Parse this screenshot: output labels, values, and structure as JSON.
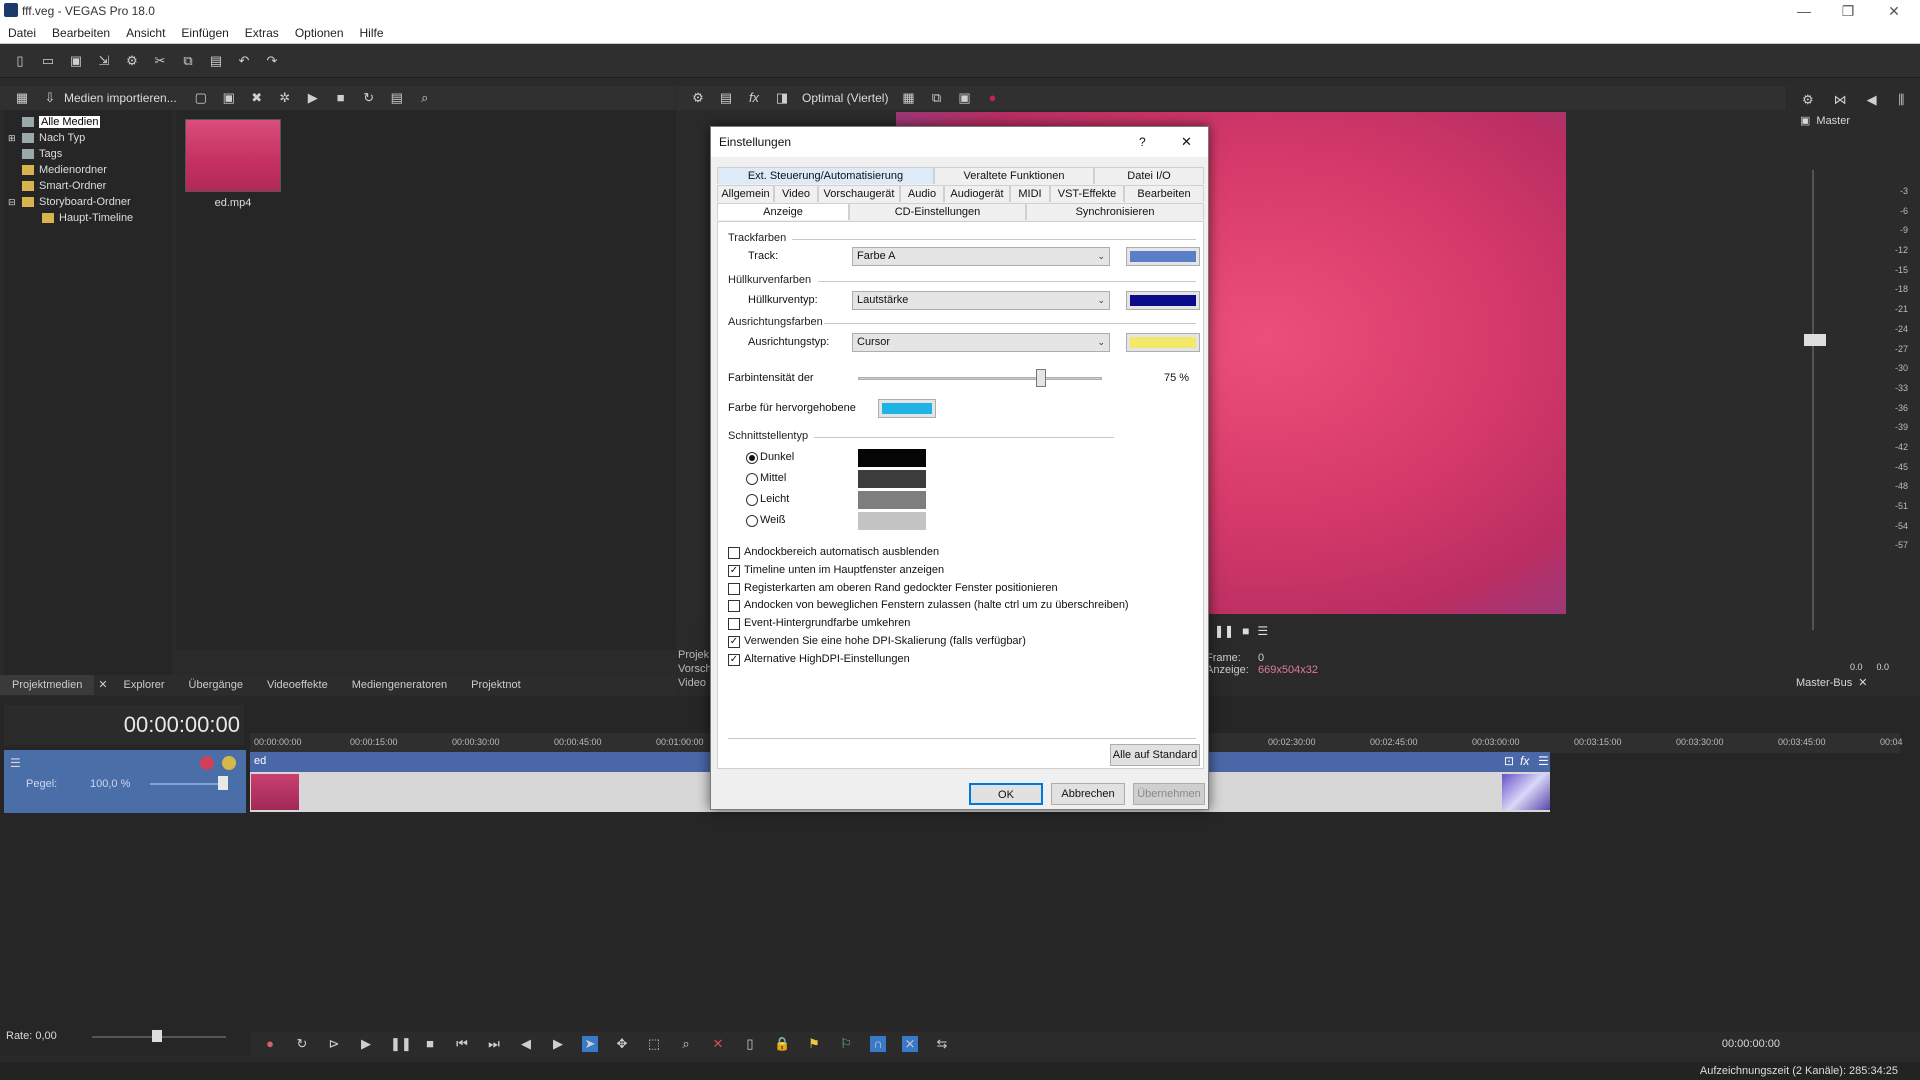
{
  "window": {
    "title": "fff.veg - VEGAS Pro 18.0"
  },
  "menu": [
    "Datei",
    "Bearbeiten",
    "Ansicht",
    "Einfügen",
    "Extras",
    "Optionen",
    "Hilfe"
  ],
  "media": {
    "import_label": "Medien importieren...",
    "tree": [
      "Alle Medien",
      "Nach Typ",
      "Tags",
      "Medienordner",
      "Smart-Ordner",
      "Storyboard-Ordner",
      "Haupt-Timeline"
    ],
    "file_name": "ed.mp4"
  },
  "bottom_tabs": [
    "Projektmedien",
    "Explorer",
    "Übergänge",
    "Videoeffekte",
    "Mediengeneratoren",
    "Projektnot"
  ],
  "preview": {
    "quality": "Optimal (Viertel)",
    "frame_label": "Frame:",
    "frame_value": "0",
    "display_label": "Anzeige:",
    "display_value": "669x504x32",
    "side_labels": [
      "Projek",
      "Vorsch",
      "Video"
    ]
  },
  "master": {
    "title": "Master",
    "tab": "Master-Bus",
    "scale": [
      "3",
      "6",
      "9",
      "12",
      "15",
      "18",
      "21",
      "24",
      "27",
      "30",
      "33",
      "36",
      "39",
      "42",
      "45",
      "48",
      "51",
      "54",
      "57"
    ],
    "left_value": "0.0",
    "right_value": "0.0"
  },
  "timeline": {
    "timecode": "00:00:00:00",
    "level_label": "Pegel:",
    "level_value": "100,0 %",
    "track_name": "ed",
    "ruler": [
      "00:00:00:00",
      "00:00:15:00",
      "00:00:30:00",
      "00:00:45:00",
      "00:01:00:00",
      "00:02:30:00",
      "00:02:45:00",
      "00:03:00:00",
      "00:03:15:00",
      "00:03:30:00",
      "00:03:45:00",
      "00:04"
    ],
    "rate": "Rate: 0,00",
    "position": "00:00:00:00"
  },
  "status": {
    "text": "Aufzeichnungszeit (2 Kanäle): 285:34:25"
  },
  "dialog": {
    "title": "Einstellungen",
    "help": "?",
    "close": "✕",
    "tabs_row1": [
      "Ext. Steuerung/Automatisierung",
      "Veraltete Funktionen",
      "Datei I/O"
    ],
    "tabs_row2": [
      "Allgemein",
      "Video",
      "Vorschaugerät",
      "Audio",
      "Audiogerät",
      "MIDI",
      "VST-Effekte",
      "Bearbeiten"
    ],
    "tabs_row3": [
      "Anzeige",
      "CD-Einstellungen",
      "Synchronisieren"
    ],
    "section_trackfarben": "Trackfarben",
    "track_label": "Track:",
    "track_value": "Farbe A",
    "track_color": "#5b7ec8",
    "section_huellkurven": "Hüllkurvenfarben",
    "envelope_label": "Hüllkurventyp:",
    "envelope_value": "Lautstärke",
    "envelope_color": "#0a0a8a",
    "section_ausrichtung": "Ausrichtungsfarben",
    "snap_label": "Ausrichtungstyp:",
    "snap_value": "Cursor",
    "snap_color": "#f2e86a",
    "intensity_label": "Farbintensität der",
    "intensity_value": "75 %",
    "intensity": 0.75,
    "highlight_label": "Farbe für hervorgehobene",
    "highlight_color": "#1eb4e6",
    "section_interface": "Schnittstellentyp",
    "themes": [
      {
        "label": "Dunkel",
        "color": "#050505",
        "selected": true
      },
      {
        "label": "Mittel",
        "color": "#3c3c3c",
        "selected": false
      },
      {
        "label": "Leicht",
        "color": "#7e7e7e",
        "selected": false
      },
      {
        "label": "Weiß",
        "color": "#c4c4c4",
        "selected": false
      }
    ],
    "options": [
      {
        "label": "Andockbereich automatisch ausblenden",
        "checked": false
      },
      {
        "label": "Timeline unten im Hauptfenster anzeigen",
        "checked": true
      },
      {
        "label": "Registerkarten am oberen Rand gedockter Fenster positionieren",
        "checked": false
      },
      {
        "label": "Andocken von beweglichen Fenstern zulassen (halte ctrl um zu überschreiben)",
        "checked": false
      },
      {
        "label": "Event-Hintergrundfarbe umkehren",
        "checked": false
      },
      {
        "label": "Verwenden Sie eine hohe DPI-Skalierung (falls verfügbar)",
        "checked": true
      },
      {
        "label": "Alternative HighDPI-Einstellungen",
        "checked": true
      }
    ],
    "reset_button": "Alle auf Standard",
    "ok_button": "OK",
    "cancel_button": "Abbrechen",
    "apply_button": "Übernehmen"
  }
}
